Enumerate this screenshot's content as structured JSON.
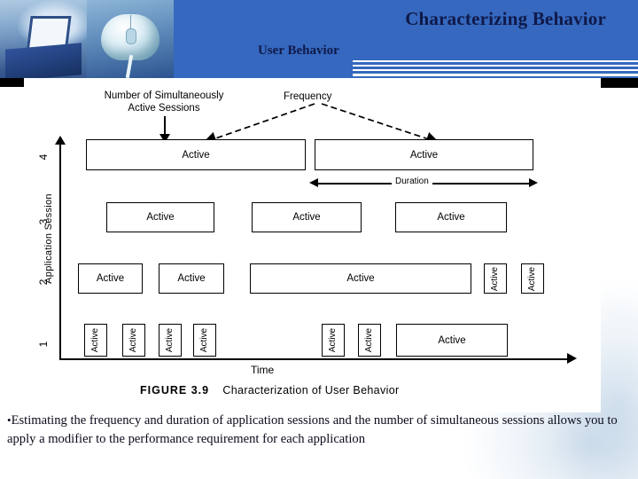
{
  "header": {
    "title": "Characterizing Behavior",
    "subtitle": "User Behavior",
    "band_color": "#3568be",
    "title_color": "#10194a",
    "photos": [
      {
        "name": "laptop-photo",
        "alt": "hands typing on a laptop"
      },
      {
        "name": "mouse-photo",
        "alt": "computer mouse"
      }
    ]
  },
  "figure": {
    "caption_prefix": "FIGURE 3.9",
    "caption_text": "Characterization of User Behavior",
    "y_axis_label": "Application Session",
    "x_axis_label": "Time",
    "y_ticks": [
      "1",
      "2",
      "3",
      "4"
    ],
    "annotations": {
      "sessions": "Number of Simultaneously\nActive Sessions",
      "sessions_line1": "Number of Simultaneously",
      "sessions_line2": "Active Sessions",
      "frequency": "Frequency",
      "duration": "Duration"
    },
    "box_label": "Active",
    "rows": [
      {
        "session": "4",
        "boxes": [
          {
            "label": "Active",
            "orientation": "horizontal"
          },
          {
            "label": "Active",
            "orientation": "horizontal"
          }
        ]
      },
      {
        "session": "3",
        "boxes": [
          {
            "label": "Active",
            "orientation": "horizontal"
          },
          {
            "label": "Active",
            "orientation": "horizontal"
          },
          {
            "label": "Active",
            "orientation": "horizontal"
          }
        ]
      },
      {
        "session": "2",
        "boxes": [
          {
            "label": "Active",
            "orientation": "horizontal"
          },
          {
            "label": "Active",
            "orientation": "horizontal"
          },
          {
            "label": "Active",
            "orientation": "horizontal"
          },
          {
            "label": "Active",
            "orientation": "vertical"
          },
          {
            "label": "Active",
            "orientation": "vertical"
          }
        ]
      },
      {
        "session": "1",
        "boxes": [
          {
            "label": "Active",
            "orientation": "vertical"
          },
          {
            "label": "Active",
            "orientation": "vertical"
          },
          {
            "label": "Active",
            "orientation": "vertical"
          },
          {
            "label": "Active",
            "orientation": "vertical"
          },
          {
            "label": "Active",
            "orientation": "vertical"
          },
          {
            "label": "Active",
            "orientation": "vertical"
          },
          {
            "label": "Active",
            "orientation": "horizontal"
          }
        ]
      }
    ]
  },
  "body": {
    "bullet_marker": "•",
    "bullet_text": "Estimating the frequency and duration of application sessions and the number of simultaneous sessions allows you to apply a modifier to the performance requirement for each application"
  }
}
